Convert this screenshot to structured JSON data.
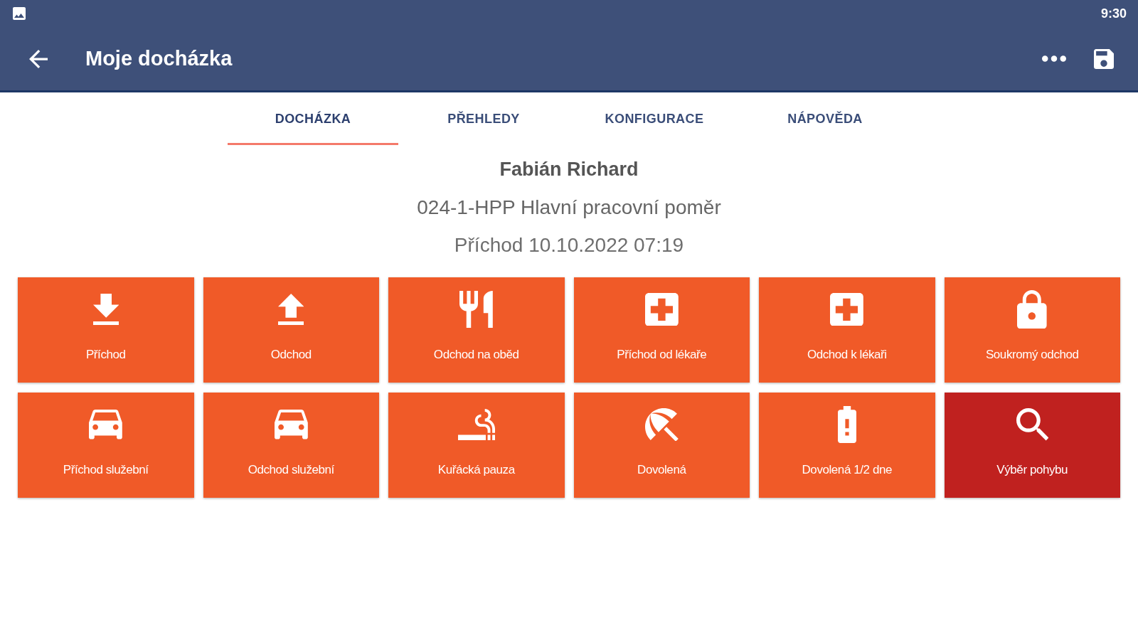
{
  "status_bar": {
    "time": "9:30"
  },
  "app_bar": {
    "title": "Moje docházka"
  },
  "tabs": [
    {
      "label": "DOCHÁZKA",
      "selected": true
    },
    {
      "label": "PŘEHLEDY",
      "selected": false
    },
    {
      "label": "KONFIGURACE",
      "selected": false
    },
    {
      "label": "NÁPOVĚDA",
      "selected": false
    }
  ],
  "employee": {
    "name": "Fabián Richard",
    "contract": "024-1-HPP Hlavní pracovní poměr",
    "last_event": "Příchod 10.10.2022 07:19"
  },
  "tiles": [
    {
      "label": "Příchod",
      "kind": "in",
      "selected": false
    },
    {
      "label": "Odchod",
      "kind": "out",
      "selected": false
    },
    {
      "label": "Odchod na oběd",
      "kind": "lunch",
      "selected": false
    },
    {
      "label": "Příchod od lékaře",
      "kind": "medical",
      "selected": false
    },
    {
      "label": "Odchod k lékaři",
      "kind": "medical",
      "selected": false
    },
    {
      "label": "Soukromý odchod",
      "kind": "lock",
      "selected": false
    },
    {
      "label": "Příchod služební",
      "kind": "car",
      "selected": false
    },
    {
      "label": "Odchod služební",
      "kind": "car",
      "selected": false
    },
    {
      "label": "Kuřácká pauza",
      "kind": "smoking",
      "selected": false
    },
    {
      "label": "Dovolená",
      "kind": "umbrella",
      "selected": false
    },
    {
      "label": "Dovolená 1/2 dne",
      "kind": "battery",
      "selected": false
    },
    {
      "label": "Výběr pohybu",
      "kind": "search",
      "selected": true
    }
  ]
}
